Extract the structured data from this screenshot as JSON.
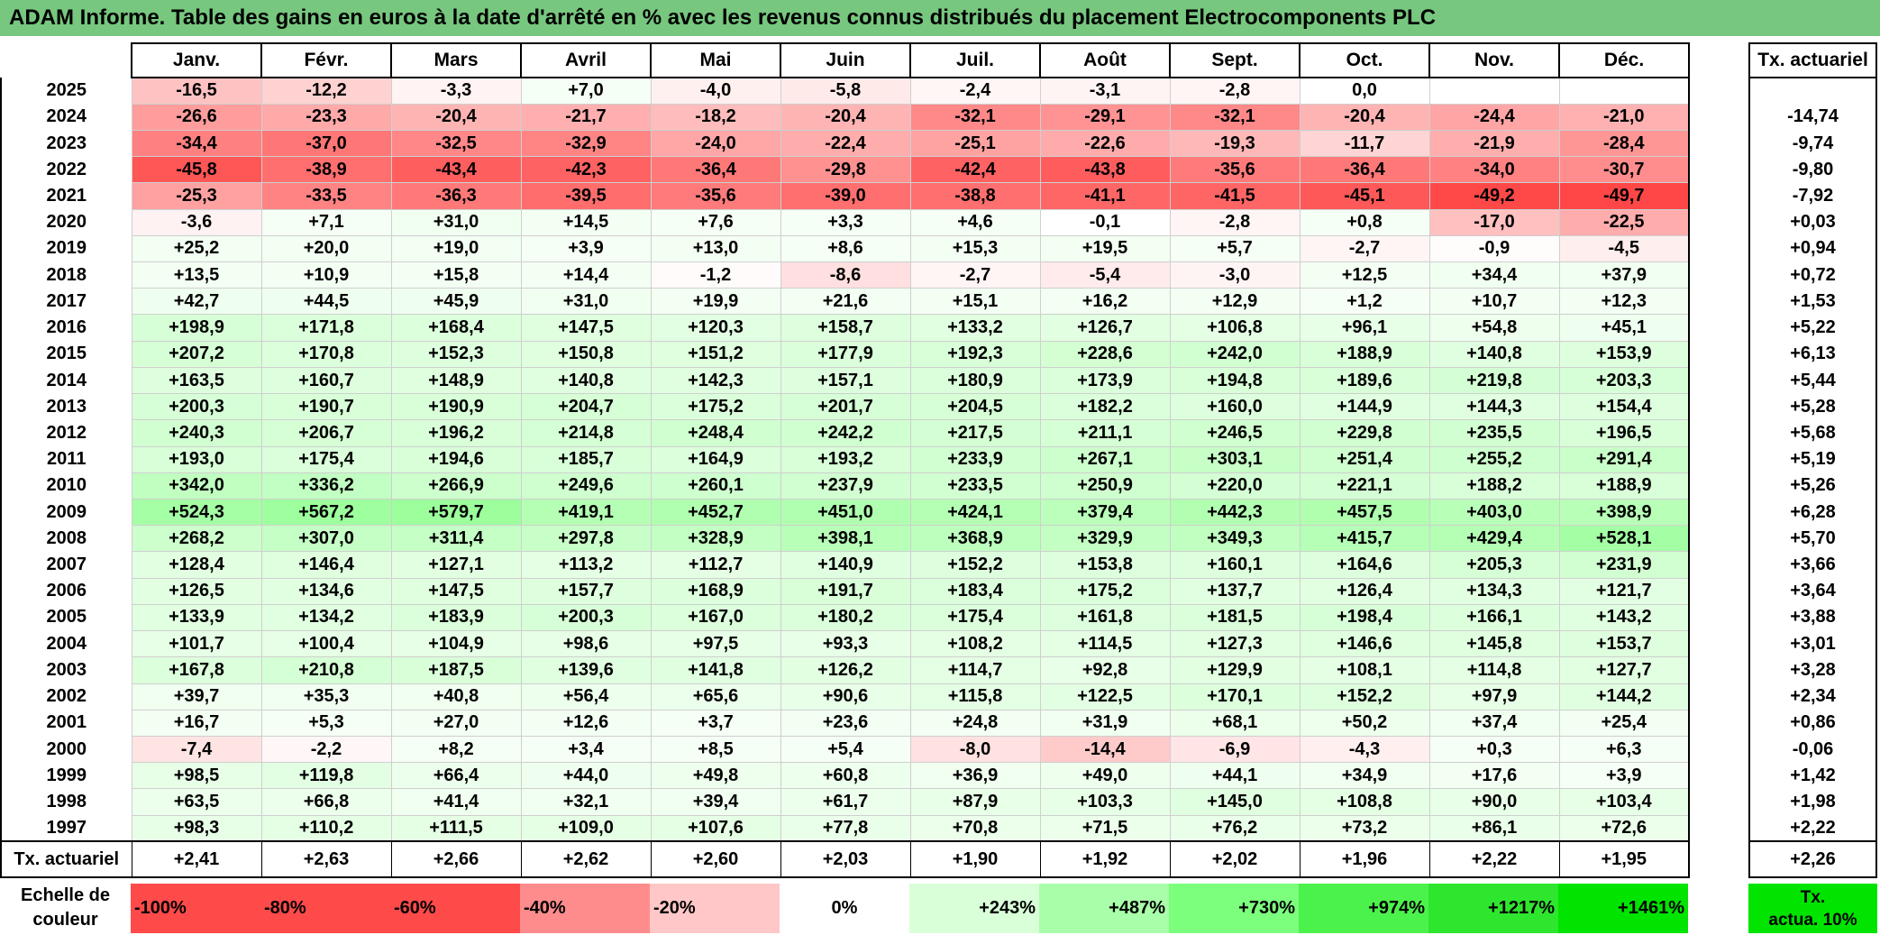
{
  "title": "ADAM Informe. Table des gains en euros à la date d'arrêté en % avec les revenus connus distribués du placement Electrocomponents PLC",
  "months": [
    "Janv.",
    "Févr.",
    "Mars",
    "Avril",
    "Mai",
    "Juin",
    "Juil.",
    "Août",
    "Sept.",
    "Oct.",
    "Nov.",
    "Déc."
  ],
  "side_header": "Tx. actuariel",
  "rows": [
    {
      "year": "2025",
      "values": [
        "-16,5",
        "-12,2",
        "-3,3",
        "+7,0",
        "-4,0",
        "-5,8",
        "-2,4",
        "-3,1",
        "-2,8",
        "0,0",
        "",
        ""
      ],
      "rate": ""
    },
    {
      "year": "2024",
      "values": [
        "-26,6",
        "-23,3",
        "-20,4",
        "-21,7",
        "-18,2",
        "-20,4",
        "-32,1",
        "-29,1",
        "-32,1",
        "-20,4",
        "-24,4",
        "-21,0"
      ],
      "rate": "-14,74"
    },
    {
      "year": "2023",
      "values": [
        "-34,4",
        "-37,0",
        "-32,5",
        "-32,9",
        "-24,0",
        "-22,4",
        "-25,1",
        "-22,6",
        "-19,3",
        "-11,7",
        "-21,9",
        "-28,4"
      ],
      "rate": "-9,74"
    },
    {
      "year": "2022",
      "values": [
        "-45,8",
        "-38,9",
        "-43,4",
        "-42,3",
        "-36,4",
        "-29,8",
        "-42,4",
        "-43,8",
        "-35,6",
        "-36,4",
        "-34,0",
        "-30,7"
      ],
      "rate": "-9,80"
    },
    {
      "year": "2021",
      "values": [
        "-25,3",
        "-33,5",
        "-36,3",
        "-39,5",
        "-35,6",
        "-39,0",
        "-38,8",
        "-41,1",
        "-41,5",
        "-45,1",
        "-49,2",
        "-49,7"
      ],
      "rate": "-7,92"
    },
    {
      "year": "2020",
      "values": [
        "-3,6",
        "+7,1",
        "+31,0",
        "+14,5",
        "+7,6",
        "+3,3",
        "+4,6",
        "-0,1",
        "-2,8",
        "+0,8",
        "-17,0",
        "-22,5"
      ],
      "rate": "+0,03"
    },
    {
      "year": "2019",
      "values": [
        "+25,2",
        "+20,0",
        "+19,0",
        "+3,9",
        "+13,0",
        "+8,6",
        "+15,3",
        "+19,5",
        "+5,7",
        "-2,7",
        "-0,9",
        "-4,5"
      ],
      "rate": "+0,94"
    },
    {
      "year": "2018",
      "values": [
        "+13,5",
        "+10,9",
        "+15,8",
        "+14,4",
        "-1,2",
        "-8,6",
        "-2,7",
        "-5,4",
        "-3,0",
        "+12,5",
        "+34,4",
        "+37,9"
      ],
      "rate": "+0,72"
    },
    {
      "year": "2017",
      "values": [
        "+42,7",
        "+44,5",
        "+45,9",
        "+31,0",
        "+19,9",
        "+21,6",
        "+15,1",
        "+16,2",
        "+12,9",
        "+1,2",
        "+10,7",
        "+12,3"
      ],
      "rate": "+1,53"
    },
    {
      "year": "2016",
      "values": [
        "+198,9",
        "+171,8",
        "+168,4",
        "+147,5",
        "+120,3",
        "+158,7",
        "+133,2",
        "+126,7",
        "+106,8",
        "+96,1",
        "+54,8",
        "+45,1"
      ],
      "rate": "+5,22"
    },
    {
      "year": "2015",
      "values": [
        "+207,2",
        "+170,8",
        "+152,3",
        "+150,8",
        "+151,2",
        "+177,9",
        "+192,3",
        "+228,6",
        "+242,0",
        "+188,9",
        "+140,8",
        "+153,9"
      ],
      "rate": "+6,13"
    },
    {
      "year": "2014",
      "values": [
        "+163,5",
        "+160,7",
        "+148,9",
        "+140,8",
        "+142,3",
        "+157,1",
        "+180,9",
        "+173,9",
        "+194,8",
        "+189,6",
        "+219,8",
        "+203,3"
      ],
      "rate": "+5,44"
    },
    {
      "year": "2013",
      "values": [
        "+200,3",
        "+190,7",
        "+190,9",
        "+204,7",
        "+175,2",
        "+201,7",
        "+204,5",
        "+182,2",
        "+160,0",
        "+144,9",
        "+144,3",
        "+154,4"
      ],
      "rate": "+5,28"
    },
    {
      "year": "2012",
      "values": [
        "+240,3",
        "+206,7",
        "+196,2",
        "+214,8",
        "+248,4",
        "+242,2",
        "+217,5",
        "+211,1",
        "+246,5",
        "+229,8",
        "+235,5",
        "+196,5"
      ],
      "rate": "+5,68"
    },
    {
      "year": "2011",
      "values": [
        "+193,0",
        "+175,4",
        "+194,6",
        "+185,7",
        "+164,9",
        "+193,2",
        "+233,9",
        "+267,1",
        "+303,1",
        "+251,4",
        "+255,2",
        "+291,4"
      ],
      "rate": "+5,19"
    },
    {
      "year": "2010",
      "values": [
        "+342,0",
        "+336,2",
        "+266,9",
        "+249,6",
        "+260,1",
        "+237,9",
        "+233,5",
        "+250,9",
        "+220,0",
        "+221,1",
        "+188,2",
        "+188,9"
      ],
      "rate": "+5,26"
    },
    {
      "year": "2009",
      "values": [
        "+524,3",
        "+567,2",
        "+579,7",
        "+419,1",
        "+452,7",
        "+451,0",
        "+424,1",
        "+379,4",
        "+442,3",
        "+457,5",
        "+403,0",
        "+398,9"
      ],
      "rate": "+6,28"
    },
    {
      "year": "2008",
      "values": [
        "+268,2",
        "+307,0",
        "+311,4",
        "+297,8",
        "+328,9",
        "+398,1",
        "+368,9",
        "+329,9",
        "+349,3",
        "+415,7",
        "+429,4",
        "+528,1"
      ],
      "rate": "+5,70"
    },
    {
      "year": "2007",
      "values": [
        "+128,4",
        "+146,4",
        "+127,1",
        "+113,2",
        "+112,7",
        "+140,9",
        "+152,2",
        "+153,8",
        "+160,1",
        "+164,6",
        "+205,3",
        "+231,9"
      ],
      "rate": "+3,66"
    },
    {
      "year": "2006",
      "values": [
        "+126,5",
        "+134,6",
        "+147,5",
        "+157,7",
        "+168,9",
        "+191,7",
        "+183,4",
        "+175,2",
        "+137,7",
        "+126,4",
        "+134,3",
        "+121,7"
      ],
      "rate": "+3,64"
    },
    {
      "year": "2005",
      "values": [
        "+133,9",
        "+134,2",
        "+183,9",
        "+200,3",
        "+167,0",
        "+180,2",
        "+175,4",
        "+161,8",
        "+181,5",
        "+198,4",
        "+166,1",
        "+143,2"
      ],
      "rate": "+3,88"
    },
    {
      "year": "2004",
      "values": [
        "+101,7",
        "+100,4",
        "+104,9",
        "+98,6",
        "+97,5",
        "+93,3",
        "+108,2",
        "+114,5",
        "+127,3",
        "+146,6",
        "+145,8",
        "+153,7"
      ],
      "rate": "+3,01"
    },
    {
      "year": "2003",
      "values": [
        "+167,8",
        "+210,8",
        "+187,5",
        "+139,6",
        "+141,8",
        "+126,2",
        "+114,7",
        "+92,8",
        "+129,9",
        "+108,1",
        "+114,8",
        "+127,7"
      ],
      "rate": "+3,28"
    },
    {
      "year": "2002",
      "values": [
        "+39,7",
        "+35,3",
        "+40,8",
        "+56,4",
        "+65,6",
        "+90,6",
        "+115,8",
        "+122,5",
        "+170,1",
        "+152,2",
        "+97,9",
        "+144,2"
      ],
      "rate": "+2,34"
    },
    {
      "year": "2001",
      "values": [
        "+16,7",
        "+5,3",
        "+27,0",
        "+12,6",
        "+3,7",
        "+23,6",
        "+24,8",
        "+31,9",
        "+68,1",
        "+50,2",
        "+37,4",
        "+25,4"
      ],
      "rate": "+0,86"
    },
    {
      "year": "2000",
      "values": [
        "-7,4",
        "-2,2",
        "+8,2",
        "+3,4",
        "+8,5",
        "+5,4",
        "-8,0",
        "-14,4",
        "-6,9",
        "-4,3",
        "+0,3",
        "+6,3"
      ],
      "rate": "-0,06"
    },
    {
      "year": "1999",
      "values": [
        "+98,5",
        "+119,8",
        "+66,4",
        "+44,0",
        "+49,8",
        "+60,8",
        "+36,9",
        "+49,0",
        "+44,1",
        "+34,9",
        "+17,6",
        "+3,9"
      ],
      "rate": "+1,42"
    },
    {
      "year": "1998",
      "values": [
        "+63,5",
        "+66,8",
        "+41,4",
        "+32,1",
        "+39,4",
        "+61,7",
        "+87,9",
        "+103,3",
        "+145,0",
        "+108,8",
        "+90,0",
        "+103,4"
      ],
      "rate": "+1,98"
    },
    {
      "year": "1997",
      "values": [
        "+98,3",
        "+110,2",
        "+111,5",
        "+109,0",
        "+107,6",
        "+77,8",
        "+70,8",
        "+71,5",
        "+76,2",
        "+73,2",
        "+86,1",
        "+72,6"
      ],
      "rate": "+2,22"
    }
  ],
  "footer": {
    "label": "Tx. actuariel",
    "values": [
      "+2,41",
      "+2,63",
      "+2,66",
      "+2,62",
      "+2,60",
      "+2,03",
      "+1,90",
      "+1,92",
      "+2,02",
      "+1,96",
      "+2,22",
      "+1,95"
    ],
    "rate": "+2,26"
  },
  "scale": {
    "label_line1": "Echelle de",
    "label_line2": "couleur",
    "swatches": [
      {
        "label": "-100%",
        "color": "#ff4a4a",
        "kind": "neg"
      },
      {
        "label": "-80%",
        "color": "#ff4a4a",
        "kind": "neg"
      },
      {
        "label": "-60%",
        "color": "#ff4a4a",
        "kind": "neg"
      },
      {
        "label": "-40%",
        "color": "#ff8c8c",
        "kind": "neg"
      },
      {
        "label": "-20%",
        "color": "#ffc7c7",
        "kind": "neg"
      },
      {
        "label": "0%",
        "color": "#ffffff",
        "kind": "zero"
      },
      {
        "label": "+243%",
        "color": "#d9ffd9",
        "kind": "pos"
      },
      {
        "label": "+487%",
        "color": "#a9ffa9",
        "kind": "pos"
      },
      {
        "label": "+730%",
        "color": "#7cff7c",
        "kind": "pos"
      },
      {
        "label": "+974%",
        "color": "#4cf24c",
        "kind": "pos"
      },
      {
        "label": "+1217%",
        "color": "#2ee62e",
        "kind": "pos"
      },
      {
        "label": "+1461%",
        "color": "#00e400",
        "kind": "pos"
      }
    ],
    "side_line1": "Tx.",
    "side_line2": "actua. 10%"
  }
}
